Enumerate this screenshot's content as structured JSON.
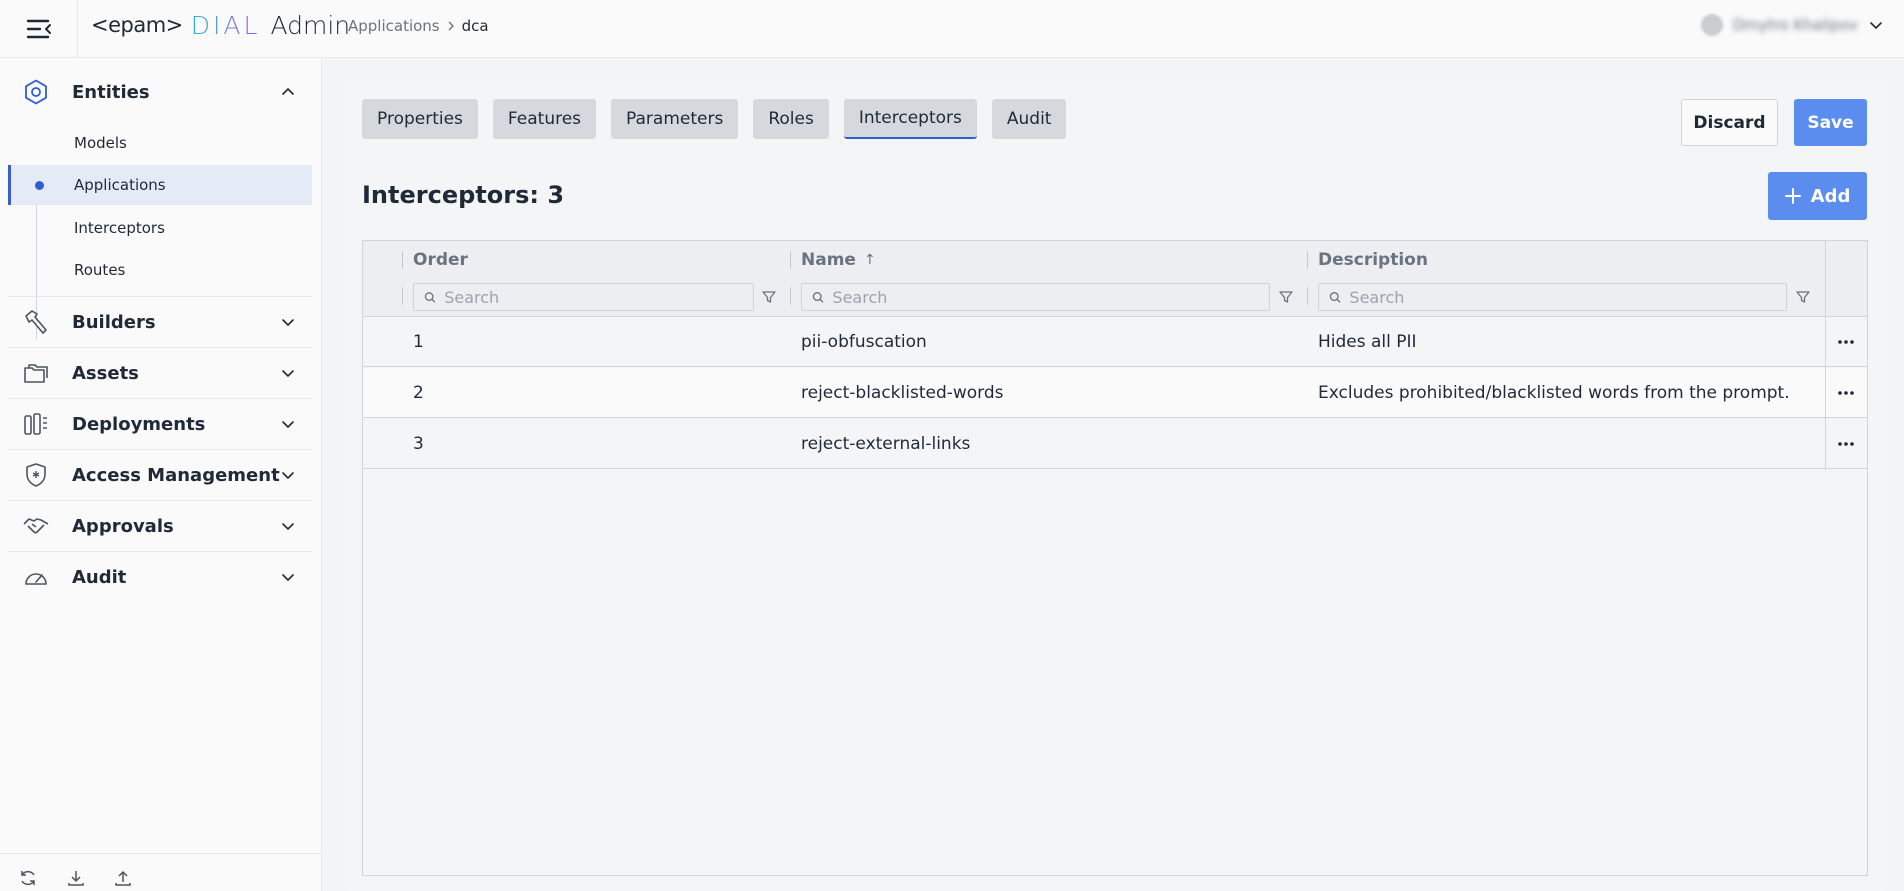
{
  "header": {
    "logo_brand": "<epam>",
    "logo_product": "DIAL",
    "logo_suffix": "Admin",
    "breadcrumb": {
      "parent": "Applications",
      "current": "dca"
    },
    "user_name": "Dmytro Khalipov"
  },
  "sidebar": {
    "sections": [
      {
        "label": "Entities",
        "icon": "hexagon-icon",
        "expanded": true
      },
      {
        "label": "Builders",
        "icon": "hammer-icon",
        "expanded": false
      },
      {
        "label": "Assets",
        "icon": "folders-icon",
        "expanded": false
      },
      {
        "label": "Deployments",
        "icon": "deployments-icon",
        "expanded": false
      },
      {
        "label": "Access Management",
        "icon": "shield-icon",
        "expanded": false
      },
      {
        "label": "Approvals",
        "icon": "handshake-icon",
        "expanded": false
      },
      {
        "label": "Audit",
        "icon": "gauge-icon",
        "expanded": false
      }
    ],
    "entities_items": [
      {
        "label": "Models",
        "active": false
      },
      {
        "label": "Applications",
        "active": true
      },
      {
        "label": "Interceptors",
        "active": false
      },
      {
        "label": "Routes",
        "active": false
      }
    ],
    "footer_icons": [
      "refresh-icon",
      "download-icon",
      "upload-icon"
    ]
  },
  "tabs": [
    {
      "label": "Properties",
      "active": false
    },
    {
      "label": "Features",
      "active": false
    },
    {
      "label": "Parameters",
      "active": false
    },
    {
      "label": "Roles",
      "active": false
    },
    {
      "label": "Interceptors",
      "active": true
    },
    {
      "label": "Audit",
      "active": false
    }
  ],
  "actions": {
    "discard": "Discard",
    "save": "Save",
    "add": "Add"
  },
  "section_title": "Interceptors: 3",
  "table": {
    "columns": [
      {
        "label": "Order",
        "sort": ""
      },
      {
        "label": "Name",
        "sort": "↑"
      },
      {
        "label": "Description",
        "sort": ""
      }
    ],
    "search_placeholder": "Search",
    "rows": [
      {
        "order": "1",
        "name": "pii-obfuscation",
        "description": "Hides all PII"
      },
      {
        "order": "2",
        "name": "reject-blacklisted-words",
        "description": "Excludes prohibited/blacklisted words from the prompt."
      },
      {
        "order": "3",
        "name": "reject-external-links",
        "description": ""
      }
    ]
  },
  "colors": {
    "accent": "#5b8def",
    "active_indicator": "#2f5fd0",
    "active_bg": "#e4ebf7"
  }
}
